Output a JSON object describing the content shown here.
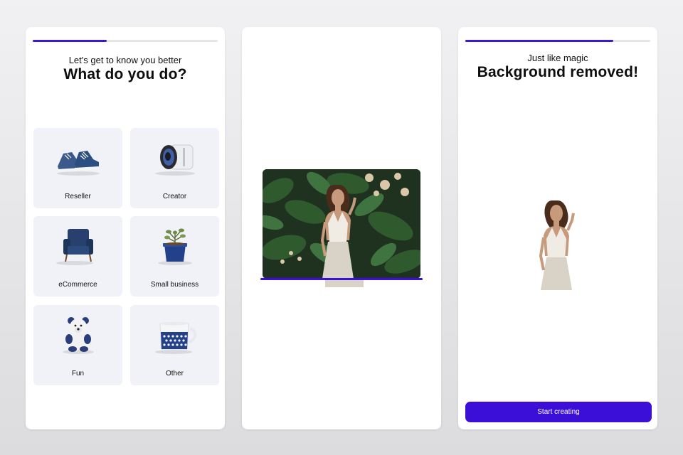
{
  "screen1": {
    "progress": 0.4,
    "subtitle": "Let's get to know you better",
    "title": "What do you do?",
    "categories": [
      {
        "label": "Reseller",
        "icon": "sneakers-icon"
      },
      {
        "label": "Creator",
        "icon": "camera-lens-icon"
      },
      {
        "label": "eCommerce",
        "icon": "armchair-icon"
      },
      {
        "label": "Small business",
        "icon": "potted-plant-icon"
      },
      {
        "label": "Fun",
        "icon": "teddy-bear-icon"
      },
      {
        "label": "Other",
        "icon": "mug-icon"
      }
    ]
  },
  "screen2": {
    "scan_progress": 1.0
  },
  "screen3": {
    "progress": 0.8,
    "subtitle": "Just like magic",
    "title": "Background removed!",
    "button_label": "Start creating"
  },
  "colors": {
    "accent": "#3b0fd8",
    "tile_bg": "#f1f2f7",
    "progress_track": "#e6e6ea"
  }
}
